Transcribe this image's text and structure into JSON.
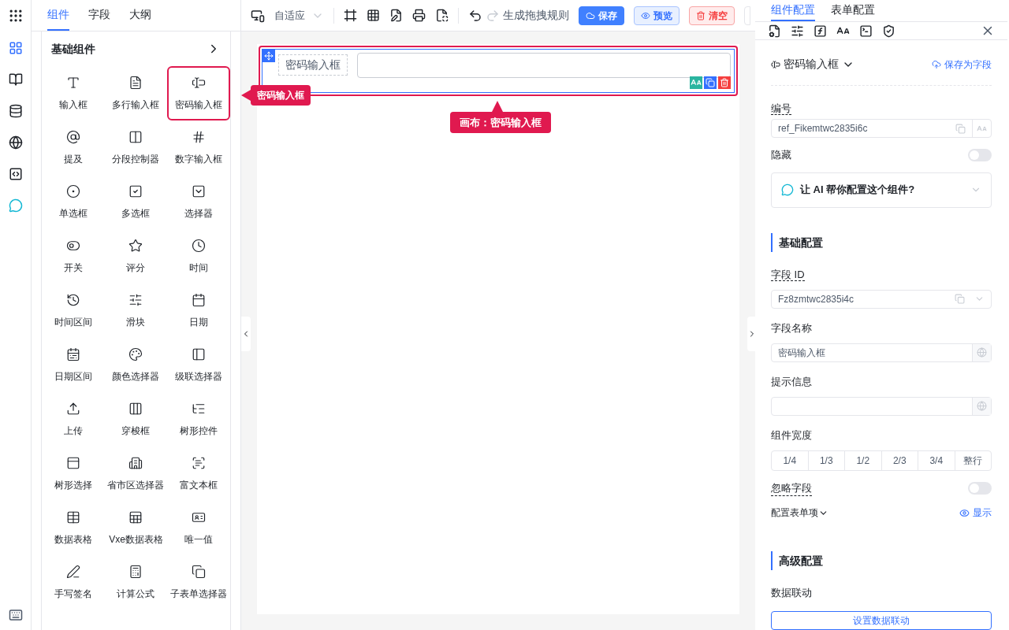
{
  "left_tabs": [
    {
      "label": "组件",
      "selected": true
    },
    {
      "label": "字段",
      "selected": false
    },
    {
      "label": "大纲",
      "selected": false
    }
  ],
  "palette": {
    "title": "基础组件",
    "items": [
      {
        "label": "输入框",
        "selected": false
      },
      {
        "label": "多行输入框",
        "selected": false
      },
      {
        "label": "密码输入框",
        "selected": true
      },
      {
        "label": "提及",
        "selected": false
      },
      {
        "label": "分段控制器",
        "selected": false
      },
      {
        "label": "数字输入框",
        "selected": false
      },
      {
        "label": "单选框",
        "selected": false
      },
      {
        "label": "多选框",
        "selected": false
      },
      {
        "label": "选择器",
        "selected": false
      },
      {
        "label": "开关",
        "selected": false
      },
      {
        "label": "评分",
        "selected": false
      },
      {
        "label": "时间",
        "selected": false
      },
      {
        "label": "时间区间",
        "selected": false
      },
      {
        "label": "滑块",
        "selected": false
      },
      {
        "label": "日期",
        "selected": false
      },
      {
        "label": "日期区间",
        "selected": false
      },
      {
        "label": "颜色选择器",
        "selected": false
      },
      {
        "label": "级联选择器",
        "selected": false
      },
      {
        "label": "上传",
        "selected": false
      },
      {
        "label": "穿梭框",
        "selected": false
      },
      {
        "label": "树形控件",
        "selected": false
      },
      {
        "label": "树形选择",
        "selected": false
      },
      {
        "label": "省市区选择器",
        "selected": false
      },
      {
        "label": "富文本框",
        "selected": false
      },
      {
        "label": "数据表格",
        "selected": false
      },
      {
        "label": "Vxe数据表格",
        "selected": false
      },
      {
        "label": "唯一值",
        "selected": false
      },
      {
        "label": "手写签名",
        "selected": false
      },
      {
        "label": "计算公式",
        "selected": false
      },
      {
        "label": "子表单选择器",
        "selected": false
      }
    ]
  },
  "toolbar": {
    "device": "自适应",
    "generate": "生成拖拽规则",
    "buttons": [
      {
        "label": "保存",
        "kind": "primary"
      },
      {
        "label": "预览",
        "kind": "secondary"
      },
      {
        "label": "清空",
        "kind": "danger"
      }
    ]
  },
  "canvas": {
    "field": {
      "label": "密码输入框",
      "selected": true
    }
  },
  "annotations": [
    {
      "kind": "left",
      "text": "密码输入框"
    },
    {
      "kind": "up",
      "text": "画布：密码输入框"
    }
  ],
  "right_tabs": [
    {
      "label": "组件配置",
      "selected": true
    },
    {
      "label": "表单配置",
      "selected": false
    }
  ],
  "config": {
    "component": "密码输入框",
    "save_as_field": "保存为字段",
    "ref_label": "编号",
    "ref_value": "ref_Fikemtwc2835i6c",
    "hidden_label": "隐藏",
    "hidden_on": false,
    "ai_prompt": "让 AI 帮你配置这个组件?",
    "basic_title": "基础配置",
    "field_id_label": "字段 ID",
    "field_id": "Fz8zmtwc2835i4c",
    "name_label": "字段名称",
    "name_value": "密码输入框",
    "hint_label": "提示信息",
    "width_label": "组件宽度",
    "widths": [
      {
        "label": "1/4",
        "selected": false
      },
      {
        "label": "1/3",
        "selected": false
      },
      {
        "label": "1/2",
        "selected": false
      },
      {
        "label": "2/3",
        "selected": false
      },
      {
        "label": "3/4",
        "selected": false
      },
      {
        "label": "整行",
        "selected": false
      }
    ],
    "ignore_label": "忽略字段",
    "ignore_on": false,
    "form_items_label": "配置表单项",
    "show_label": "显示",
    "advanced_title": "高级配置",
    "linkage_label": "数据联动",
    "linkage_button": "设置数据联动"
  }
}
